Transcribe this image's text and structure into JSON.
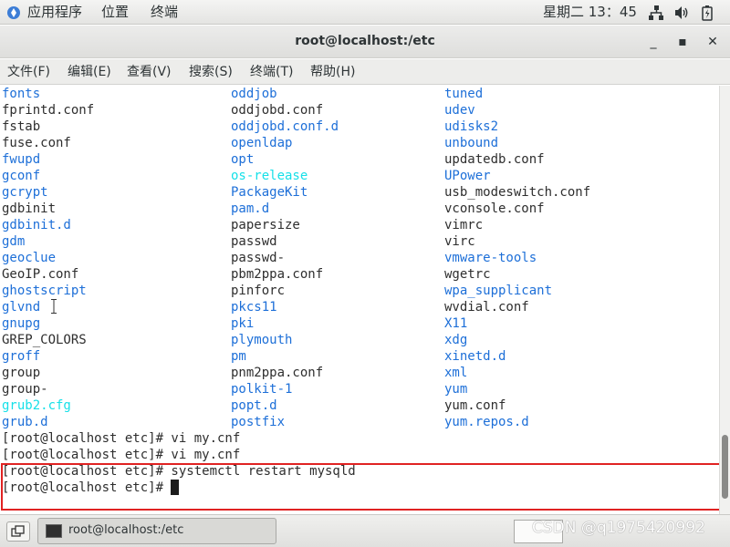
{
  "top_panel": {
    "apps_label": "应用程序",
    "places_label": "位置",
    "terminal_label": "终端",
    "clock": "星期二 13：45"
  },
  "window": {
    "title": "root@localhost:/etc",
    "minimize": "_",
    "maximize": "▪",
    "close": "✕"
  },
  "menubar": {
    "file": "文件(F)",
    "edit": "编辑(E)",
    "view": "查看(V)",
    "search": "搜索(S)",
    "terminal": "终端(T)",
    "help": "帮助(H)"
  },
  "listing": [
    [
      {
        "t": "fonts",
        "c": "blue"
      },
      {
        "t": "oddjob",
        "c": "blue"
      },
      {
        "t": "tuned",
        "c": "blue"
      }
    ],
    [
      {
        "t": "fprintd.conf",
        "c": "dark"
      },
      {
        "t": "oddjobd.conf",
        "c": "dark"
      },
      {
        "t": "udev",
        "c": "blue"
      }
    ],
    [
      {
        "t": "fstab",
        "c": "dark"
      },
      {
        "t": "oddjobd.conf.d",
        "c": "blue"
      },
      {
        "t": "udisks2",
        "c": "blue"
      }
    ],
    [
      {
        "t": "fuse.conf",
        "c": "dark"
      },
      {
        "t": "openldap",
        "c": "blue"
      },
      {
        "t": "unbound",
        "c": "blue"
      }
    ],
    [
      {
        "t": "fwupd",
        "c": "blue"
      },
      {
        "t": "opt",
        "c": "blue"
      },
      {
        "t": "updatedb.conf",
        "c": "dark"
      }
    ],
    [
      {
        "t": "gconf",
        "c": "blue"
      },
      {
        "t": "os-release",
        "c": "cyan"
      },
      {
        "t": "UPower",
        "c": "blue"
      }
    ],
    [
      {
        "t": "gcrypt",
        "c": "blue"
      },
      {
        "t": "PackageKit",
        "c": "blue"
      },
      {
        "t": "usb_modeswitch.conf",
        "c": "dark"
      }
    ],
    [
      {
        "t": "gdbinit",
        "c": "dark"
      },
      {
        "t": "pam.d",
        "c": "blue"
      },
      {
        "t": "vconsole.conf",
        "c": "dark"
      }
    ],
    [
      {
        "t": "gdbinit.d",
        "c": "blue"
      },
      {
        "t": "papersize",
        "c": "dark"
      },
      {
        "t": "vimrc",
        "c": "dark"
      }
    ],
    [
      {
        "t": "gdm",
        "c": "blue"
      },
      {
        "t": "passwd",
        "c": "dark"
      },
      {
        "t": "virc",
        "c": "dark"
      }
    ],
    [
      {
        "t": "geoclue",
        "c": "blue"
      },
      {
        "t": "passwd-",
        "c": "dark"
      },
      {
        "t": "vmware-tools",
        "c": "blue"
      }
    ],
    [
      {
        "t": "GeoIP.conf",
        "c": "dark"
      },
      {
        "t": "pbm2ppa.conf",
        "c": "dark"
      },
      {
        "t": "wgetrc",
        "c": "dark"
      }
    ],
    [
      {
        "t": "ghostscript",
        "c": "blue"
      },
      {
        "t": "pinforc",
        "c": "dark"
      },
      {
        "t": "wpa_supplicant",
        "c": "blue"
      }
    ],
    [
      {
        "t": "glvnd",
        "c": "blue"
      },
      {
        "t": "pkcs11",
        "c": "blue"
      },
      {
        "t": "wvdial.conf",
        "c": "dark"
      }
    ],
    [
      {
        "t": "gnupg",
        "c": "blue"
      },
      {
        "t": "pki",
        "c": "blue"
      },
      {
        "t": "X11",
        "c": "blue"
      }
    ],
    [
      {
        "t": "GREP_COLORS",
        "c": "dark"
      },
      {
        "t": "plymouth",
        "c": "blue"
      },
      {
        "t": "xdg",
        "c": "blue"
      }
    ],
    [
      {
        "t": "groff",
        "c": "blue"
      },
      {
        "t": "pm",
        "c": "blue"
      },
      {
        "t": "xinetd.d",
        "c": "blue"
      }
    ],
    [
      {
        "t": "group",
        "c": "dark"
      },
      {
        "t": "pnm2ppa.conf",
        "c": "dark"
      },
      {
        "t": "xml",
        "c": "blue"
      }
    ],
    [
      {
        "t": "group-",
        "c": "dark"
      },
      {
        "t": "polkit-1",
        "c": "blue"
      },
      {
        "t": "yum",
        "c": "blue"
      }
    ],
    [
      {
        "t": "grub2.cfg",
        "c": "cyan"
      },
      {
        "t": "popt.d",
        "c": "blue"
      },
      {
        "t": "yum.conf",
        "c": "dark"
      }
    ],
    [
      {
        "t": "grub.d",
        "c": "blue"
      },
      {
        "t": "postfix",
        "c": "blue"
      },
      {
        "t": "yum.repos.d",
        "c": "blue"
      }
    ]
  ],
  "commands": [
    "[root@localhost etc]# vi my.cnf",
    "[root@localhost etc]# vi my.cnf",
    "[root@localhost etc]# systemctl restart mysqld",
    "[root@localhost etc]# "
  ],
  "taskbar": {
    "task_label": "root@localhost:/etc",
    "watermark": "CSDN @q1975420992"
  },
  "colors": {
    "dir_blue": "#1d6fd8",
    "symlink_cyan": "#16e0e8",
    "highlight_red": "#e02222"
  }
}
